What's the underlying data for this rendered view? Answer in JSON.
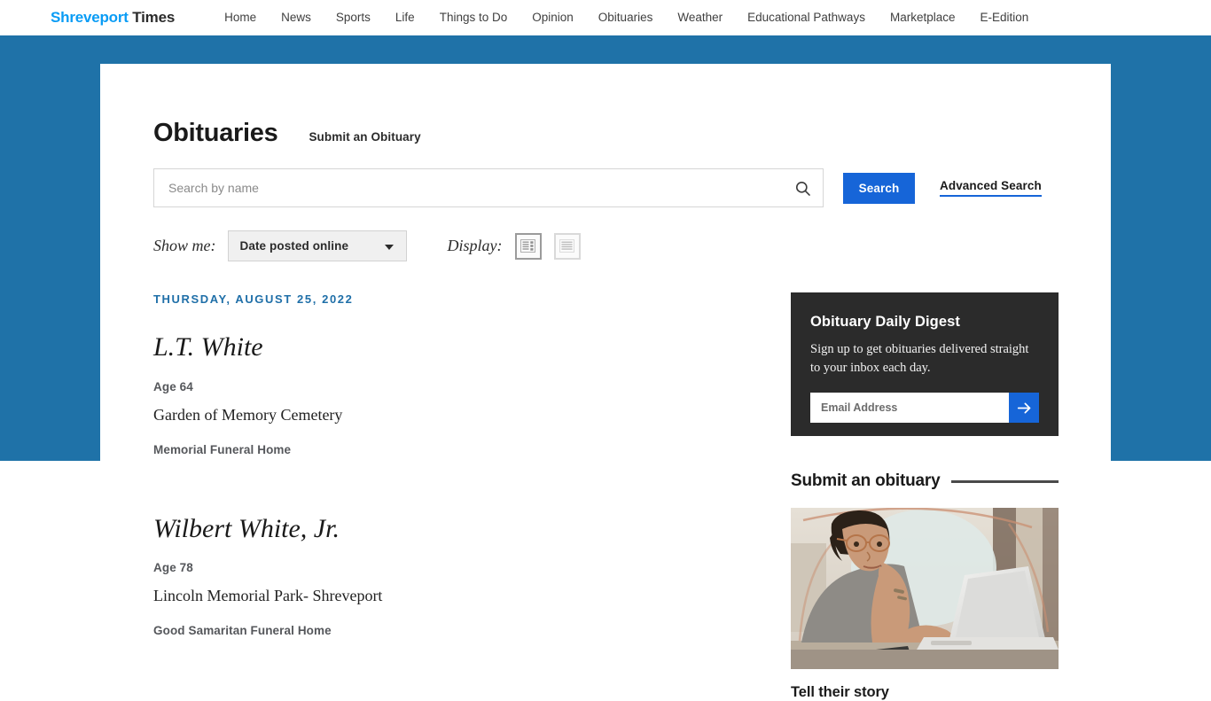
{
  "site": {
    "brand_primary": "Shreveport",
    "brand_secondary": "Times",
    "brand_color": "#0a9cf5",
    "accent_blue": "#1665d8",
    "backdrop_blue": "#1f72a8"
  },
  "nav": {
    "items": [
      {
        "label": "Home"
      },
      {
        "label": "News"
      },
      {
        "label": "Sports"
      },
      {
        "label": "Life"
      },
      {
        "label": "Things to Do"
      },
      {
        "label": "Opinion"
      },
      {
        "label": "Obituaries"
      },
      {
        "label": "Weather"
      },
      {
        "label": "Educational Pathways"
      },
      {
        "label": "Marketplace"
      },
      {
        "label": "E-Edition"
      }
    ]
  },
  "page": {
    "title": "Obituaries",
    "submit_link": "Submit an Obituary"
  },
  "search": {
    "placeholder": "Search by name",
    "value": "",
    "button_label": "Search",
    "advanced_label": "Advanced Search",
    "icon": "search-icon"
  },
  "filters": {
    "show_me_label": "Show me:",
    "sort_value": "Date posted online",
    "sort_options": [
      "Date posted online"
    ],
    "display_label": "Display:",
    "display_modes": [
      {
        "name": "grid-view",
        "active": true
      },
      {
        "name": "list-view",
        "active": false
      }
    ]
  },
  "obituaries": {
    "date_heading": "THURSDAY, AUGUST 25, 2022",
    "entries": [
      {
        "name": "L.T. White",
        "age": "Age 64",
        "place": "Garden of Memory Cemetery",
        "funeral_home": "Memorial Funeral Home"
      },
      {
        "name": "Wilbert White, Jr.",
        "age": "Age 78",
        "place": "Lincoln Memorial Park- Shreveport",
        "funeral_home": "Good Samaritan Funeral Home"
      }
    ]
  },
  "sidebar": {
    "digest": {
      "title": "Obituary Daily Digest",
      "description": "Sign up to get obituaries delivered straight to your inbox each day.",
      "email_placeholder": "Email Address",
      "email_value": "",
      "submit_icon": "arrow-right-icon",
      "background": "#2b2b2b"
    },
    "submit_section": {
      "heading": "Submit an obituary",
      "caption": "Tell their story",
      "photo_alt": "woman-at-laptop-photo"
    }
  }
}
